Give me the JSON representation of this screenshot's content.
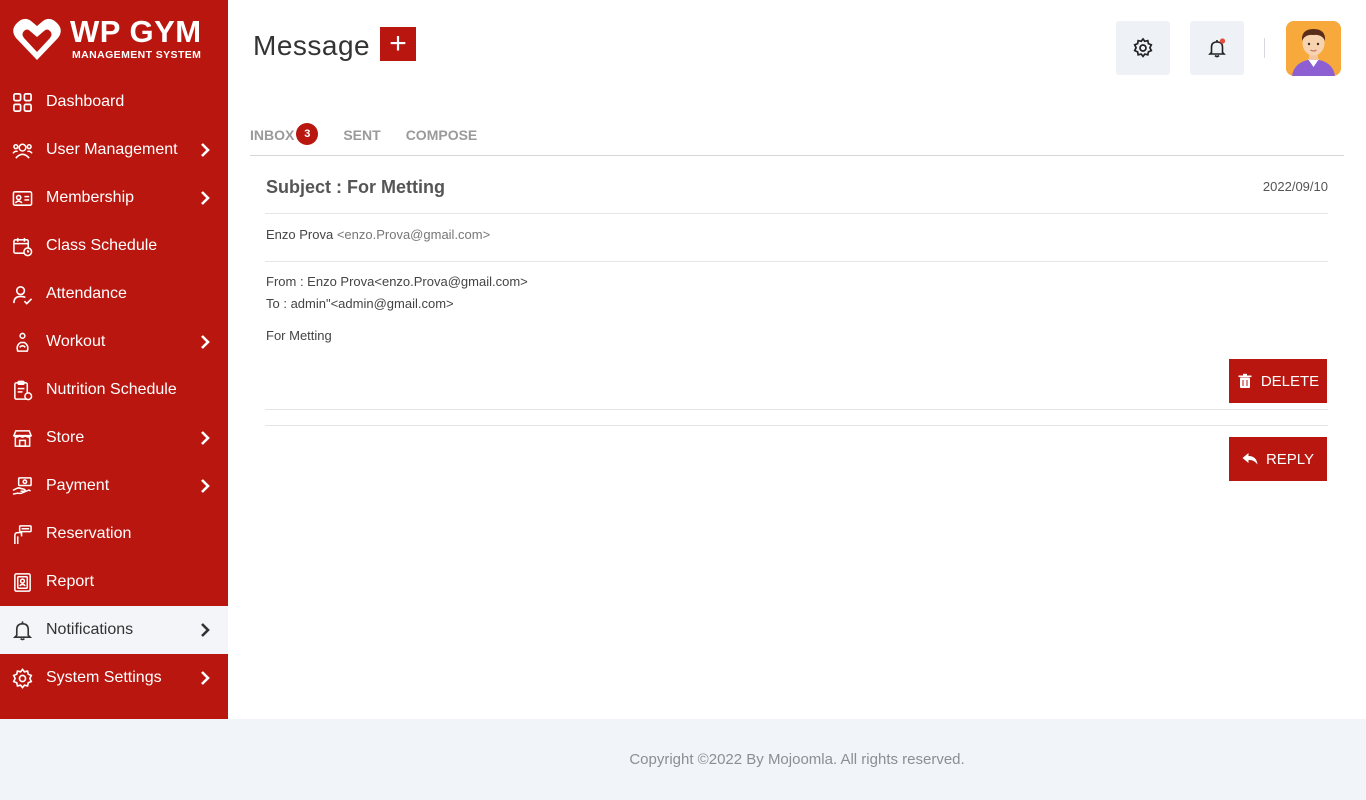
{
  "brand": {
    "title": "WP GYM",
    "subtitle": "MANAGEMENT SYSTEM",
    "accent": "#b8160e"
  },
  "sidebar": {
    "items": [
      {
        "label": "Dashboard",
        "icon": "dashboard-icon",
        "chevron": false
      },
      {
        "label": "User Management",
        "icon": "users-icon",
        "chevron": true
      },
      {
        "label": "Membership",
        "icon": "membership-card-icon",
        "chevron": true
      },
      {
        "label": "Class Schedule",
        "icon": "calendar-icon",
        "chevron": false
      },
      {
        "label": "Attendance",
        "icon": "user-check-icon",
        "chevron": false
      },
      {
        "label": "Workout",
        "icon": "workout-icon",
        "chevron": true
      },
      {
        "label": "Nutrition Schedule",
        "icon": "nutrition-clipboard-icon",
        "chevron": false
      },
      {
        "label": "Store",
        "icon": "store-icon",
        "chevron": true
      },
      {
        "label": "Payment",
        "icon": "payment-hand-icon",
        "chevron": true
      },
      {
        "label": "Reservation",
        "icon": "reservation-icon",
        "chevron": false
      },
      {
        "label": "Report",
        "icon": "report-icon",
        "chevron": false
      },
      {
        "label": "Notifications",
        "icon": "bell-icon",
        "chevron": true,
        "active": true
      },
      {
        "label": "System Settings",
        "icon": "gear-icon",
        "chevron": true
      }
    ]
  },
  "header": {
    "title": "Message",
    "add_symbol": "+"
  },
  "tabs": [
    {
      "label": "INBOX",
      "badge": "3"
    },
    {
      "label": "SENT"
    },
    {
      "label": "COMPOSE"
    }
  ],
  "message": {
    "subject": "Subject : For Metting",
    "date": "2022/09/10",
    "sender_name": "Enzo Prova",
    "sender_email": "<enzo.Prova@gmail.com>",
    "from_line": "From : Enzo Prova<enzo.Prova@gmail.com>",
    "to_line": "To : admin\"<admin@gmail.com>",
    "body": "For Metting"
  },
  "buttons": {
    "delete": "DELETE",
    "reply": "REPLY"
  },
  "footer": {
    "text": "Copyright ©2022 By Mojoomla. All rights reserved."
  }
}
